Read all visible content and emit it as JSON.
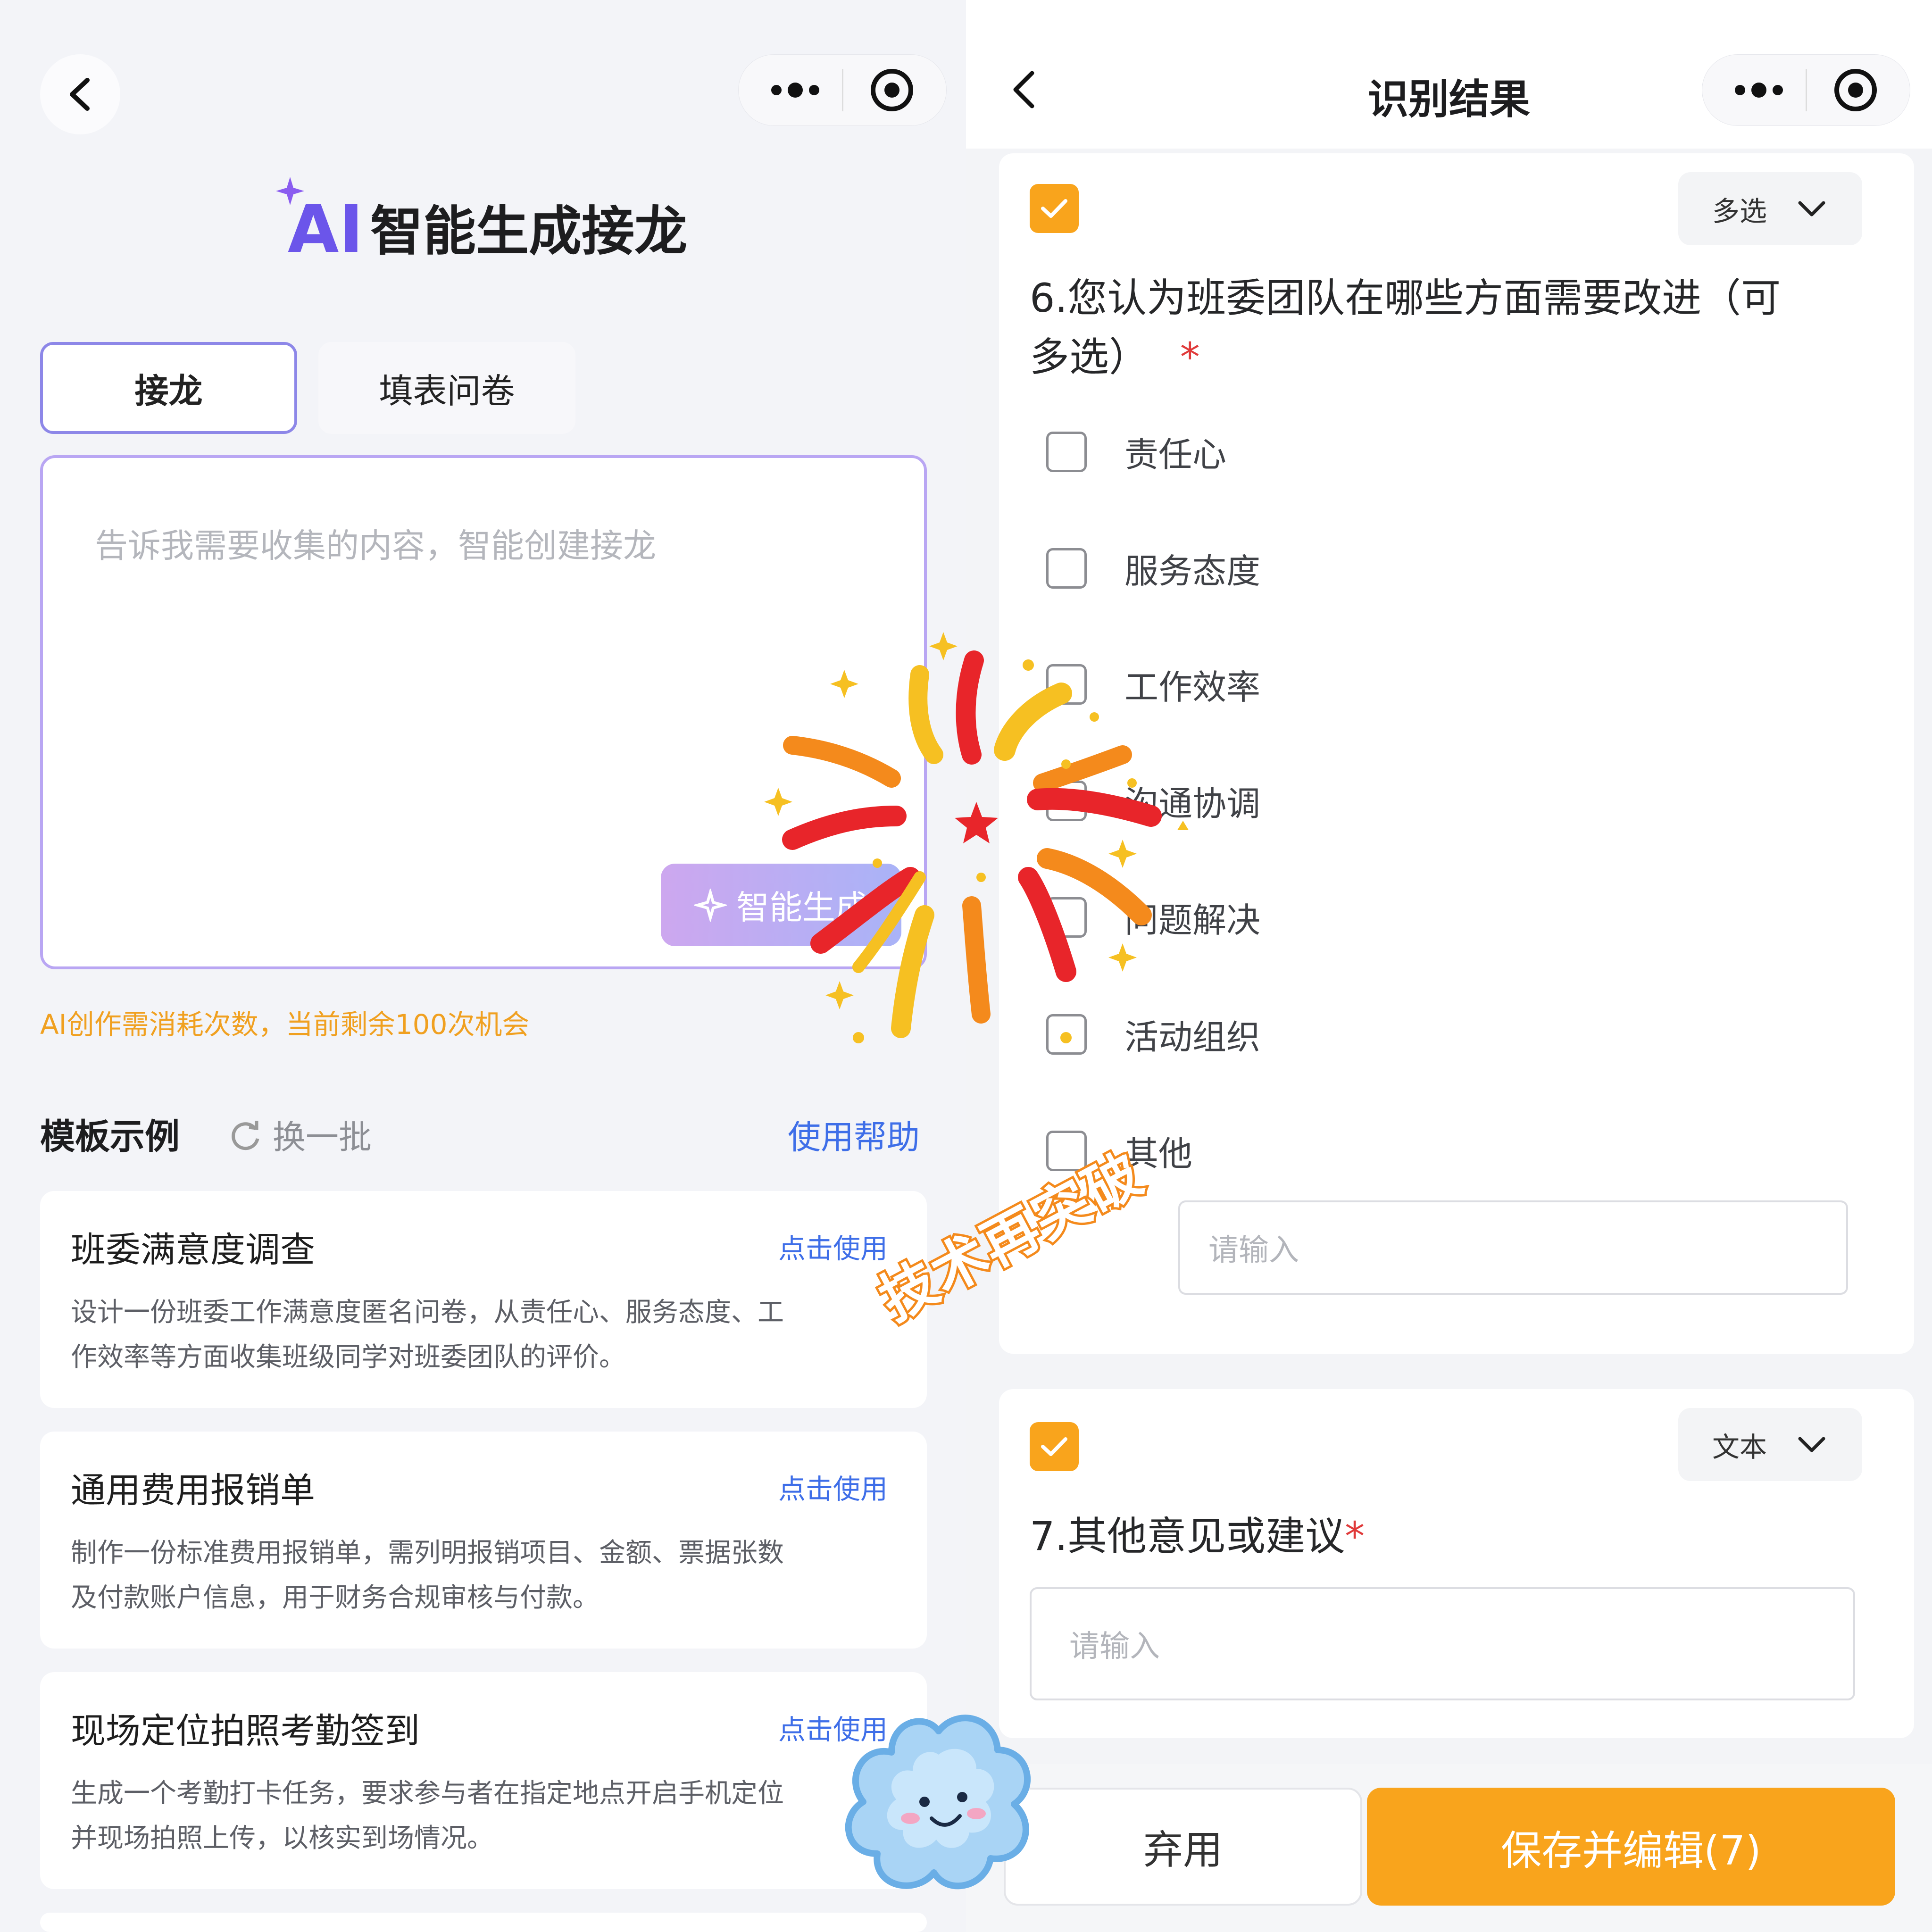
{
  "left": {
    "header_title": "智能生成接龙",
    "ai_logo": "AI",
    "tabs": [
      {
        "label": "接龙",
        "active": true
      },
      {
        "label": "填表问卷",
        "active": false
      }
    ],
    "prompt_placeholder": "告诉我需要收集的内容，智能创建接龙",
    "generate_button": "智能生成",
    "quota_note": "AI创作需消耗次数，当前剩余100次机会",
    "templates_heading": "模板示例",
    "refresh_label": "换一批",
    "help_link": "使用帮助",
    "templates": [
      {
        "title": "班委满意度调查",
        "action": "点击使用",
        "desc_line1": "设计一份班委工作满意度匿名问卷，从责任心、服务态度、工",
        "desc_line2": "作效率等方面收集班级同学对班委团队的评价。"
      },
      {
        "title": "通用费用报销单",
        "action": "点击使用",
        "desc_line1": "制作一份标准费用报销单，需列明报销项目、金额、票据张数",
        "desc_line2": "及付款账户信息，用于财务合规审核与付款。"
      },
      {
        "title": "现场定位拍照考勤签到",
        "action": "点击使用",
        "desc_line1": "生成一个考勤打卡任务，要求参与者在指定地点开启手机定位",
        "desc_line2": "并现场拍照上传，以核实到场情况。"
      }
    ]
  },
  "right": {
    "page_title": "识别结果",
    "q6": {
      "type": "多选",
      "line1": "6.您认为班委团队在哪些方面需要改进（可",
      "line2": "多选）",
      "required_mark": "*",
      "options": [
        "责任心",
        "服务态度",
        "工作效率",
        "沟通协调",
        "问题解决",
        "活动组织",
        "其他"
      ],
      "other_placeholder": "请输入"
    },
    "q7": {
      "type": "文本",
      "title": "7.其他意见或建议",
      "required_mark": "*",
      "placeholder": "请输入"
    },
    "discard_button": "弃用",
    "save_button": "保存并编辑(7)"
  },
  "sticker_text": "技术再突破",
  "colors": {
    "accent": "#f9a41c",
    "link": "#3e6ee8",
    "purple": "#b9a6f3",
    "quota": "#f0a020"
  }
}
